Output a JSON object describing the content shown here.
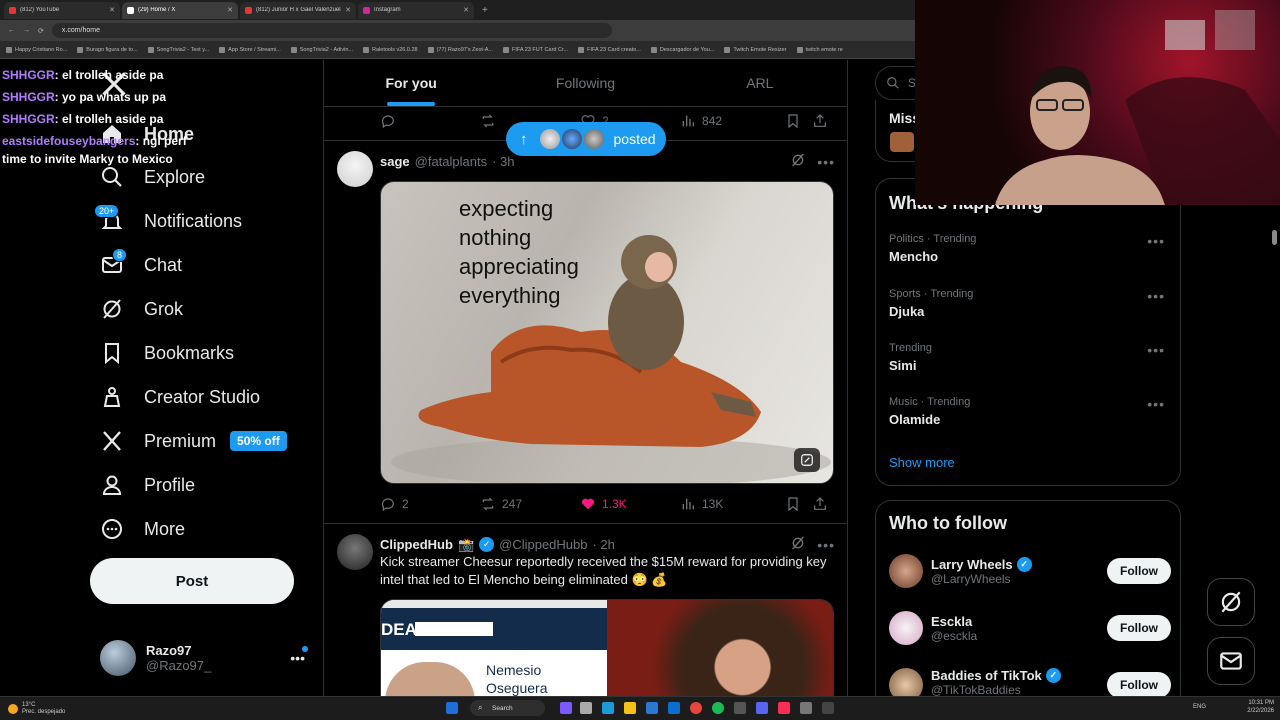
{
  "browser": {
    "tabs": [
      {
        "title": "(812) YouTube",
        "active": false
      },
      {
        "title": "(29) Home / X",
        "active": true
      },
      {
        "title": "(812) Junior H x Gael Valenzuela",
        "active": false
      },
      {
        "title": "Instagram",
        "active": false
      }
    ],
    "url": "x.com/home",
    "bookmarks": [
      "Happy Cristiano Ro...",
      "Burago figura de to...",
      "SongTrivia2 - Test y...",
      "App Store / Streami...",
      "SongTrivia2 - Adivin...",
      "Raletools v26.0.28",
      "(77) Razo97's Zest-A...",
      "FIFA 23 FUT Card Cr...",
      "FIFA 23 Card creato...",
      "Descargador de You...",
      "Twitch Emote Resizer",
      "twitch emote re"
    ]
  },
  "chat": [
    {
      "user": "SHHGGR",
      "msg": ": el trolleh aside pa"
    },
    {
      "user": "SHHGGR",
      "msg": ": yo pa whats up pa"
    },
    {
      "user": "SHHGGR",
      "msg": ": el trolleh aside pa"
    },
    {
      "user": "eastsidefouseybangers",
      "msg": ": ngl perf time to invite Marky to Mexico"
    }
  ],
  "nav": {
    "home": "Home",
    "explore": "Explore",
    "notifications": "Notifications",
    "notifications_badge": "20+",
    "chat": "Chat",
    "chat_badge": "8",
    "grok": "Grok",
    "bookmarks": "Bookmarks",
    "creator_studio": "Creator Studio",
    "premium": "Premium",
    "premium_pill": "50% off",
    "profile": "Profile",
    "more": "More",
    "post": "Post"
  },
  "account": {
    "name": "Razo97",
    "handle": "@Razo97_"
  },
  "feed_tabs": [
    "For you",
    "Following",
    "ARL"
  ],
  "prev_tweet_actions": {
    "retweets": "",
    "likes": "2",
    "views": "842"
  },
  "posted_pill": "posted",
  "tweet1": {
    "name": "sage",
    "handle": "@fatalplants",
    "time": "· 3h",
    "meme_lines": [
      "expecting",
      "nothing",
      "appreciating",
      "everything"
    ],
    "replies": "2",
    "retweets": "247",
    "likes": "1.3K",
    "views": "13K"
  },
  "tweet2": {
    "name": "ClippedHub",
    "handle": "@ClippedHubb",
    "time": "· 2h",
    "text": "Kick streamer Cheesur reportedly received the $15M reward for providing key intel that led to El Mencho being eliminated 😳 💰",
    "media_caption_1": "DEA",
    "media_caption_2": "Nemesio",
    "media_caption_3": "Oseguera"
  },
  "right": {
    "search_placeholder": "Se",
    "miss_label": "Miss",
    "whats_happening": "What's happening",
    "trends": [
      {
        "category": "Politics · Trending",
        "name": "Mencho"
      },
      {
        "category": "Sports · Trending",
        "name": "Djuka"
      },
      {
        "category": "Trending",
        "name": "Simi"
      },
      {
        "category": "Music · Trending",
        "name": "Olamide"
      }
    ],
    "show_more": "Show more",
    "who_to_follow": "Who to follow",
    "suggestions": [
      {
        "name": "Larry Wheels",
        "handle": "@LarryWheels",
        "verified": true
      },
      {
        "name": "Esckla",
        "handle": "@esckla",
        "verified": false
      },
      {
        "name": "Baddies of TikTok",
        "handle": "@TikTokBaddies",
        "verified": true
      }
    ],
    "follow_label": "Follow"
  },
  "taskbar": {
    "weather": "13°C",
    "weather_desc": "Prec. despejado",
    "search": "Search",
    "lang": "ENG",
    "time": "10:31 PM",
    "date": "2/22/2026"
  },
  "colors": {
    "accent": "#1d9bf0",
    "like": "#f91880",
    "bg": "#000000",
    "border": "#2f3336"
  }
}
